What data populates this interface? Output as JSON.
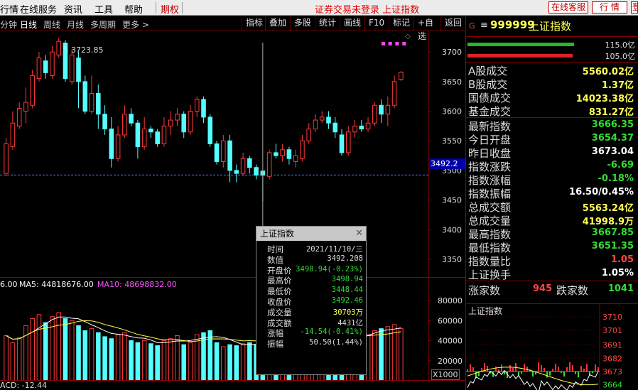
{
  "menu": {
    "items": [
      "行情",
      "在线服务",
      "资讯",
      "工具",
      "帮助"
    ],
    "qiquan": "期权",
    "status": "证券交易未登录 上证指数",
    "btn_service": "在线客服",
    "btn_quote": "行 情",
    "btn_login": "登"
  },
  "toolbar": {
    "periods": [
      "分钟",
      "日线",
      "周线",
      "月线",
      "多周期",
      "更多 >"
    ],
    "active_period": "日线",
    "buttons": [
      "指标",
      "叠加",
      "多股",
      "统计",
      "画线",
      "F10",
      "标记",
      "+自选",
      "返回"
    ]
  },
  "kline": {
    "high_label": "3723.85",
    "price_ticks": [
      "3700",
      "3650",
      "3600",
      "3550",
      "3500",
      "3450",
      "3400",
      "3350"
    ],
    "ref_price": "3492.2"
  },
  "chart_data": {
    "type": "candlestick",
    "ylim": [
      3320,
      3735
    ],
    "candles": [
      {
        "o": 3495,
        "c": 3545,
        "h": 3555,
        "l": 3490
      },
      {
        "o": 3540,
        "c": 3580,
        "h": 3600,
        "l": 3535
      },
      {
        "o": 3575,
        "c": 3605,
        "h": 3615,
        "l": 3570
      },
      {
        "o": 3600,
        "c": 3615,
        "h": 3640,
        "l": 3580
      },
      {
        "o": 3610,
        "c": 3660,
        "h": 3670,
        "l": 3605
      },
      {
        "o": 3655,
        "c": 3690,
        "h": 3700,
        "l": 3650
      },
      {
        "o": 3685,
        "c": 3665,
        "h": 3695,
        "l": 3655
      },
      {
        "o": 3660,
        "c": 3700,
        "h": 3710,
        "l": 3655
      },
      {
        "o": 3695,
        "c": 3718,
        "h": 3724,
        "l": 3690
      },
      {
        "o": 3715,
        "c": 3655,
        "h": 3720,
        "l": 3650
      },
      {
        "o": 3650,
        "c": 3695,
        "h": 3705,
        "l": 3645
      },
      {
        "o": 3690,
        "c": 3650,
        "h": 3700,
        "l": 3605
      },
      {
        "o": 3650,
        "c": 3600,
        "h": 3660,
        "l": 3595
      },
      {
        "o": 3600,
        "c": 3630,
        "h": 3660,
        "l": 3595
      },
      {
        "o": 3630,
        "c": 3595,
        "h": 3645,
        "l": 3570
      },
      {
        "o": 3595,
        "c": 3570,
        "h": 3610,
        "l": 3560
      },
      {
        "o": 3570,
        "c": 3520,
        "h": 3590,
        "l": 3505
      },
      {
        "o": 3520,
        "c": 3560,
        "h": 3575,
        "l": 3515
      },
      {
        "o": 3560,
        "c": 3595,
        "h": 3610,
        "l": 3555
      },
      {
        "o": 3595,
        "c": 3580,
        "h": 3605,
        "l": 3575
      },
      {
        "o": 3580,
        "c": 3540,
        "h": 3585,
        "l": 3520
      },
      {
        "o": 3540,
        "c": 3570,
        "h": 3590,
        "l": 3535
      },
      {
        "o": 3570,
        "c": 3565,
        "h": 3575,
        "l": 3555
      },
      {
        "o": 3565,
        "c": 3545,
        "h": 3570,
        "l": 3540
      },
      {
        "o": 3545,
        "c": 3575,
        "h": 3590,
        "l": 3540
      },
      {
        "o": 3575,
        "c": 3585,
        "h": 3600,
        "l": 3560
      },
      {
        "o": 3585,
        "c": 3595,
        "h": 3605,
        "l": 3575
      },
      {
        "o": 3595,
        "c": 3565,
        "h": 3600,
        "l": 3555
      },
      {
        "o": 3565,
        "c": 3600,
        "h": 3610,
        "l": 3560
      },
      {
        "o": 3600,
        "c": 3620,
        "h": 3625,
        "l": 3590
      },
      {
        "o": 3620,
        "c": 3590,
        "h": 3625,
        "l": 3580
      },
      {
        "o": 3590,
        "c": 3545,
        "h": 3595,
        "l": 3540
      },
      {
        "o": 3545,
        "c": 3515,
        "h": 3550,
        "l": 3510
      },
      {
        "o": 3515,
        "c": 3550,
        "h": 3560,
        "l": 3505
      },
      {
        "o": 3550,
        "c": 3500,
        "h": 3560,
        "l": 3480
      },
      {
        "o": 3500,
        "c": 3495,
        "h": 3510,
        "l": 3480
      },
      {
        "o": 3495,
        "c": 3520,
        "h": 3530,
        "l": 3490
      },
      {
        "o": 3520,
        "c": 3505,
        "h": 3525,
        "l": 3495
      },
      {
        "o": 3505,
        "c": 3492,
        "h": 3510,
        "l": 3485
      },
      {
        "o": 3499,
        "c": 3492,
        "h": 3499,
        "l": 3448
      },
      {
        "o": 3490,
        "c": 3530,
        "h": 3535,
        "l": 3485
      },
      {
        "o": 3530,
        "c": 3525,
        "h": 3545,
        "l": 3520
      },
      {
        "o": 3525,
        "c": 3535,
        "h": 3545,
        "l": 3515
      },
      {
        "o": 3535,
        "c": 3520,
        "h": 3540,
        "l": 3510
      },
      {
        "o": 3515,
        "c": 3525,
        "h": 3535,
        "l": 3505
      },
      {
        "o": 3520,
        "c": 3550,
        "h": 3560,
        "l": 3515
      },
      {
        "o": 3550,
        "c": 3570,
        "h": 3580,
        "l": 3545
      },
      {
        "o": 3570,
        "c": 3585,
        "h": 3595,
        "l": 3565
      },
      {
        "o": 3585,
        "c": 3590,
        "h": 3600,
        "l": 3580
      },
      {
        "o": 3590,
        "c": 3580,
        "h": 3600,
        "l": 3570
      },
      {
        "o": 3580,
        "c": 3565,
        "h": 3590,
        "l": 3555
      },
      {
        "o": 3560,
        "c": 3530,
        "h": 3570,
        "l": 3525
      },
      {
        "o": 3530,
        "c": 3565,
        "h": 3575,
        "l": 3525
      },
      {
        "o": 3565,
        "c": 3575,
        "h": 3585,
        "l": 3555
      },
      {
        "o": 3575,
        "c": 3570,
        "h": 3585,
        "l": 3565
      },
      {
        "o": 3570,
        "c": 3580,
        "h": 3590,
        "l": 3565
      },
      {
        "o": 3580,
        "c": 3610,
        "h": 3615,
        "l": 3575
      },
      {
        "o": 3610,
        "c": 3595,
        "h": 3620,
        "l": 3580
      },
      {
        "o": 3595,
        "c": 3610,
        "h": 3625,
        "l": 3575
      },
      {
        "o": 3610,
        "c": 3650,
        "h": 3660,
        "l": 3605
      },
      {
        "o": 3654,
        "c": 3666,
        "h": 3668,
        "l": 3651
      }
    ],
    "volume_ticks": [
      "80000",
      "60000",
      "40000",
      "20000"
    ],
    "volume_unit": "X1000",
    "volumes": [
      45,
      38,
      43,
      55,
      62,
      66,
      58,
      64,
      68,
      62,
      60,
      55,
      50,
      52,
      48,
      44,
      42,
      46,
      48,
      40,
      38,
      40,
      37,
      35,
      40,
      42,
      45,
      36,
      38,
      46,
      48,
      50,
      38,
      34,
      36,
      35,
      37,
      38,
      36,
      31,
      42,
      44,
      40,
      38,
      36,
      40,
      44,
      46,
      48,
      45,
      40,
      38,
      42,
      48,
      52,
      46,
      50,
      52,
      54,
      56,
      52
    ]
  },
  "ma_legend": {
    "vol_prefix": "6.00",
    "ma5": "MA5: 44818676.00",
    "ma10": "MA10: 48698832.00"
  },
  "macd_label": "ACD: -12.44",
  "tooltip": {
    "title": "上证指数",
    "rows": [
      {
        "label": "时间",
        "value": "2021/11/10/三",
        "color": "#dddddd"
      },
      {
        "label": "数值",
        "value": "3492.208",
        "color": "#dddddd"
      },
      {
        "label": "开盘价",
        "value": "3498.94(-0.23%)",
        "color": "#33dd33"
      },
      {
        "label": "最高价",
        "value": "3498.94",
        "color": "#33dd33"
      },
      {
        "label": "最低价",
        "value": "3448.44",
        "color": "#33dd33"
      },
      {
        "label": "收盘价",
        "value": "3492.46",
        "color": "#33dd33"
      },
      {
        "label": "成交量",
        "value": "30703万",
        "color": "#ffff55"
      },
      {
        "label": "成交额",
        "value": "4431亿",
        "color": "#dddddd"
      },
      {
        "label": "涨幅",
        "value": "-14.54(-0.41%)",
        "color": "#33dd33"
      },
      {
        "label": "振幅",
        "value": "50.50(1.44%)",
        "color": "#dddddd"
      }
    ]
  },
  "right_panel": {
    "code": "999999",
    "name": "上证指数",
    "bar1_label": "115.0亿",
    "bar2_label": "105.0亿",
    "rows1": [
      {
        "label": "A股成交",
        "value": "5560.02亿",
        "color": "yellow"
      },
      {
        "label": "B股成交",
        "value": "1.37亿",
        "color": "yellow"
      },
      {
        "label": "国债成交",
        "value": "14023.38亿",
        "color": "yellow"
      },
      {
        "label": "基金成交",
        "value": "831.27亿",
        "color": "yellow"
      }
    ],
    "rows2": [
      {
        "label": "最新指数",
        "value": "3666.35",
        "color": "green"
      },
      {
        "label": "今日开盘",
        "value": "3654.37",
        "color": "green"
      },
      {
        "label": "昨日收盘",
        "value": "3673.04",
        "color": "white"
      },
      {
        "label": "指数涨跌",
        "value": "-6.69",
        "color": "green"
      },
      {
        "label": "指数涨幅",
        "value": "-0.18%",
        "color": "green"
      },
      {
        "label": "指数振幅",
        "value": "16.50/0.45%",
        "color": "white"
      },
      {
        "label": "总成交额",
        "value": "5563.24亿",
        "color": "yellow"
      },
      {
        "label": "总成交量",
        "value": "41998.9万",
        "color": "yellow"
      },
      {
        "label": "最高指数",
        "value": "3667.85",
        "color": "green"
      },
      {
        "label": "最低指数",
        "value": "3651.35",
        "color": "green"
      },
      {
        "label": "指数量比",
        "value": "1.05",
        "color": "red"
      },
      {
        "label": "上证换手",
        "value": "1.05%",
        "color": "white"
      }
    ],
    "up_label": "涨家数",
    "up_count": "945",
    "down_label": "跌家数",
    "down_count": "1041",
    "mini_title": "上证指数",
    "mini_ticks": [
      "3710",
      "3701",
      "3691",
      "3682",
      "3673",
      "3664"
    ]
  }
}
